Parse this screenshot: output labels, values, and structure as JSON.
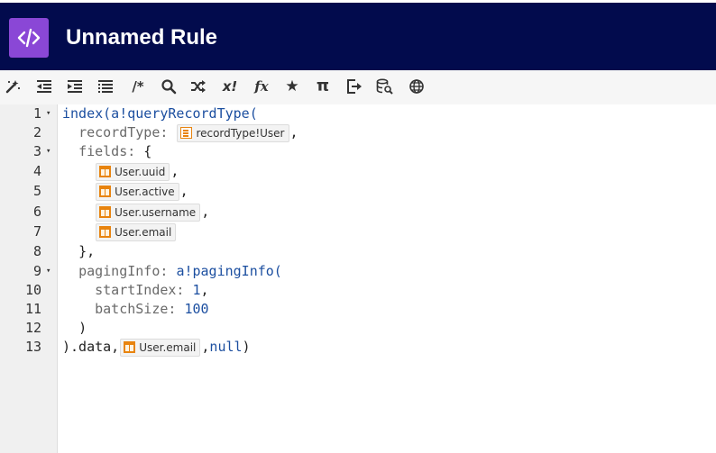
{
  "header": {
    "logo_glyph": "</>",
    "title": "Unnamed Rule",
    "background": "#020b4d",
    "logo_color": "#8a47d6"
  },
  "toolbar": {
    "buttons": [
      {
        "icon": "magic-wand-icon"
      },
      {
        "icon": "outdent-icon"
      },
      {
        "icon": "indent-icon"
      },
      {
        "icon": "list-icon"
      },
      {
        "icon": "comment-icon",
        "label": "/*"
      },
      {
        "icon": "search-icon"
      },
      {
        "icon": "shuffle-icon"
      },
      {
        "icon": "variable-icon",
        "label": "x!"
      },
      {
        "icon": "function-icon",
        "label": "fx"
      },
      {
        "icon": "star-icon",
        "label": "★"
      },
      {
        "icon": "pi-icon",
        "label": "π"
      },
      {
        "icon": "export-icon"
      },
      {
        "icon": "database-search-icon"
      },
      {
        "icon": "globe-icon"
      }
    ]
  },
  "editor": {
    "line_numbers": [
      "1",
      "2",
      "3",
      "4",
      "5",
      "6",
      "7",
      "8",
      "9",
      "10",
      "11",
      "12",
      "13"
    ],
    "fold_marker": "▾",
    "fold_lines": [
      1,
      3,
      9
    ],
    "code": {
      "l1_fn": "index(a!queryRecordType(",
      "l2_key": "recordType:",
      "l2_token": "recordType!User",
      "l2_after": ",",
      "l3_key": "fields:",
      "l3_after": " {",
      "l4_token": "User.uuid",
      "l4_after": ",",
      "l5_token": "User.active",
      "l5_after": ",",
      "l6_token": "User.username",
      "l6_after": ",",
      "l7_token": "User.email",
      "l8_text": "},",
      "l9_key": "pagingInfo:",
      "l9_fn": "a!pagingInfo(",
      "l10_key": "startIndex:",
      "l10_num": "1",
      "l10_after": ",",
      "l11_key": "batchSize:",
      "l11_num": "100",
      "l12_text": ")",
      "l13_before": ").data,",
      "l13_token": "User.email",
      "l13_after_sep": ",",
      "l13_null": "null",
      "l13_close": ")"
    }
  }
}
